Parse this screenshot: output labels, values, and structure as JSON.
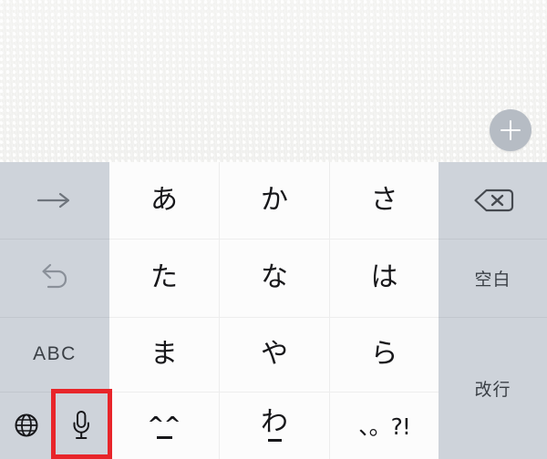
{
  "app": {
    "screen_name": "japanese-kana-keyboard",
    "note_area_background": "#f2f2f0"
  },
  "content": {
    "add_button": {
      "icon": "plus-icon",
      "label": "+",
      "color": "#b6bcc4",
      "glyph_color": "#ffffff"
    }
  },
  "keyboard": {
    "type": "kana-10-key",
    "key_colors": {
      "function_key": "#ced3da",
      "character_key": "#fcfcfc",
      "text": "#17171a",
      "function_text": "#3a3f45",
      "highlight": "#e8252a"
    },
    "rows": [
      {
        "row": 1,
        "keys": [
          {
            "name": "cursor-right-key",
            "icon": "arrow-right-icon",
            "label": "→",
            "type": "function"
          },
          {
            "name": "kana-a-key",
            "label": "あ",
            "type": "character"
          },
          {
            "name": "kana-ka-key",
            "label": "か",
            "type": "character"
          },
          {
            "name": "kana-sa-key",
            "label": "さ",
            "type": "character"
          },
          {
            "name": "delete-key",
            "icon": "backspace-icon",
            "label": "⌫",
            "type": "function"
          }
        ]
      },
      {
        "row": 2,
        "keys": [
          {
            "name": "undo-key",
            "icon": "undo-arrow-icon",
            "label": "↺",
            "type": "function"
          },
          {
            "name": "kana-ta-key",
            "label": "た",
            "type": "character"
          },
          {
            "name": "kana-na-key",
            "label": "な",
            "type": "character"
          },
          {
            "name": "kana-ha-key",
            "label": "は",
            "type": "character"
          },
          {
            "name": "space-key",
            "label": "空白",
            "type": "function"
          }
        ]
      },
      {
        "row": 3,
        "keys": [
          {
            "name": "abc-mode-key",
            "label": "ABC",
            "type": "function"
          },
          {
            "name": "kana-ma-key",
            "label": "ま",
            "type": "character"
          },
          {
            "name": "kana-ya-key",
            "label": "や",
            "type": "character"
          },
          {
            "name": "kana-ra-key",
            "label": "ら",
            "type": "character"
          },
          {
            "name": "return-key",
            "label": "改行",
            "type": "function"
          }
        ]
      },
      {
        "row": 4,
        "keys": [
          {
            "name": "globe-key",
            "icon": "globe-icon",
            "label": "🌐",
            "type": "function"
          },
          {
            "name": "microphone-key",
            "icon": "microphone-icon",
            "label": "🎤",
            "type": "function",
            "highlighted": true
          },
          {
            "name": "emoticon-key",
            "label": "^^",
            "sublabel": "_",
            "type": "character"
          },
          {
            "name": "kana-wa-key",
            "label": "わ",
            "sublabel": "_",
            "type": "character"
          },
          {
            "name": "punctuation-key",
            "label": "、。?!",
            "type": "character"
          }
        ]
      }
    ]
  },
  "annotation": {
    "highlight_target": "microphone-key",
    "highlight_color": "#e8252a",
    "highlight_style": "red-rectangle-outline"
  }
}
